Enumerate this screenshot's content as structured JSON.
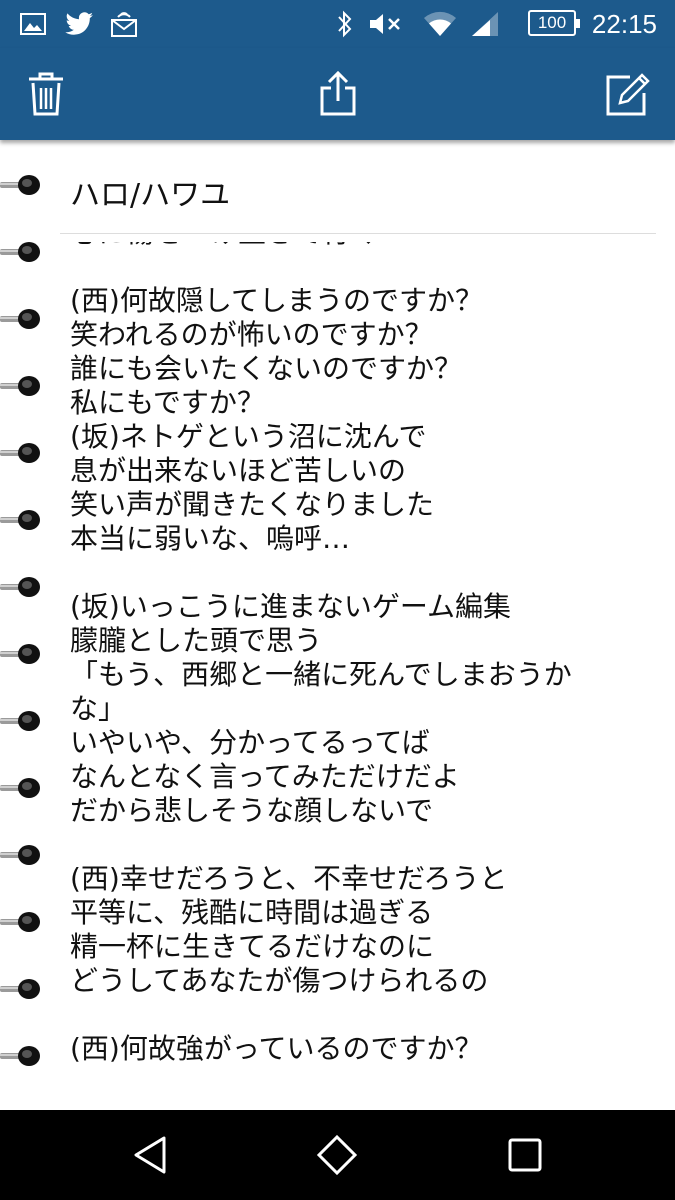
{
  "status_bar": {
    "battery": "100",
    "time": "22:15"
  },
  "toolbar": {
    "buttons": [
      "trash-icon",
      "share-icon",
      "edit-icon"
    ]
  },
  "note": {
    "title": "ハロ/ハワユ",
    "lines": [
      "心に傷をつけ生きて行く",
      "",
      "(西)何故隠してしまうのですか？",
      "笑われるのが怖いのですか？",
      "誰にも会いたくないのですか？",
      "私にもですか？",
      "(坂)ネトゲという沼に沈んで",
      "息が出来ないほど苦しいの",
      "笑い声が聞きたくなりました",
      "本当に弱いな、嗚呼…",
      "",
      "(坂)いっこうに進まないゲーム編集",
      "朦朧とした頭で思う",
      "「もう、西郷と一緒に死んでしまおうか",
      "な」",
      "いやいや、分かってるってば",
      "なんとなく言ってみただけだよ",
      "だから悲しそうな顔しないで",
      "",
      "(西)幸せだろうと、不幸せだろうと",
      "平等に、残酷に時間は過ぎる",
      "精一杯に生きてるだけなのに",
      "どうしてあなたが傷つけられるの",
      "",
      "(西)何故強がっているのですか？"
    ]
  },
  "nav_bar": {
    "buttons": [
      "back-icon",
      "home-icon",
      "recents-icon"
    ]
  }
}
